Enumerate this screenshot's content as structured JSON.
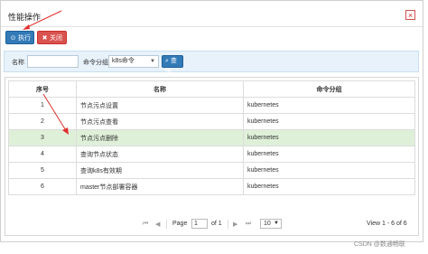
{
  "dialog": {
    "title": "性能操作",
    "close_glyph": "×"
  },
  "toolbar": {
    "exec_label": "执行",
    "exec_icon": "⊙",
    "close_label": "关闭",
    "close_icon": "✖"
  },
  "filter": {
    "name_label": "名称",
    "name_value": "",
    "group_label": "命令分组",
    "group_value": "k8s命令",
    "query_label": "查询",
    "query_icon": "🔍"
  },
  "table": {
    "headers": [
      "序号",
      "名称",
      "命令分组"
    ],
    "rows": [
      {
        "idx": "1",
        "name": "节点污点设置",
        "group": "kubernetes"
      },
      {
        "idx": "2",
        "name": "节点污点查看",
        "group": "kubernetes"
      },
      {
        "idx": "3",
        "name": "节点污点删除",
        "group": "kubernetes"
      },
      {
        "idx": "4",
        "name": "查询节点状态",
        "group": "kubernetes"
      },
      {
        "idx": "5",
        "name": "查询k8s有效期",
        "group": "kubernetes"
      },
      {
        "idx": "6",
        "name": "master节点部署容器",
        "group": "kubernetes"
      }
    ],
    "selected_row": 3
  },
  "pager": {
    "page_label": "Page",
    "page_value": "1",
    "of_label": "of 1",
    "page_size": "10",
    "view_text": "View 1 - 6 of 6"
  },
  "watermark": "CSDN @数通畅联",
  "colors": {
    "primary": "#337ab7",
    "danger": "#d9534f",
    "selected_row": "#dff0d8",
    "filter_bg": "#e8f2fa",
    "annotation_arrow": "#e03030"
  }
}
